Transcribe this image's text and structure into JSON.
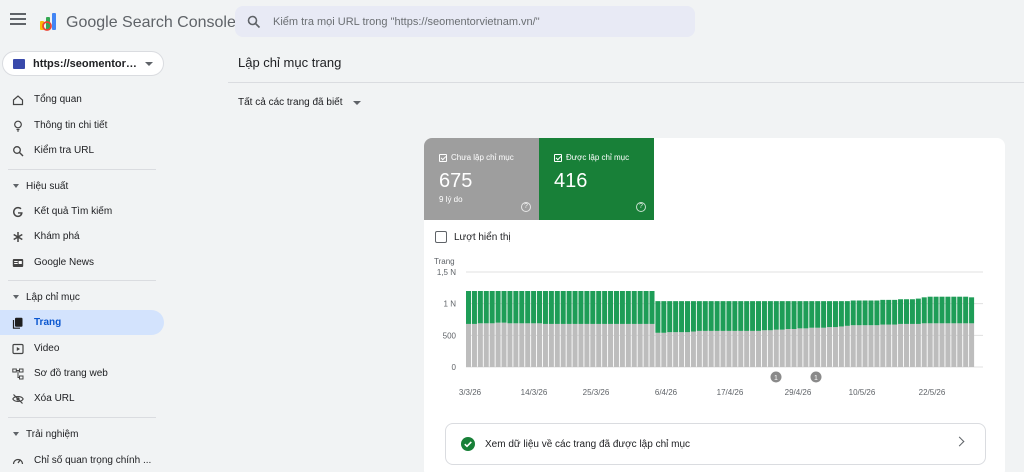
{
  "app": {
    "brand": "Google Search Console"
  },
  "search": {
    "placeholder": "Kiểm tra mọi URL trong \"https://seomentorvietnam.vn/\""
  },
  "property": {
    "label": "https://seomentorvietnam.vn/"
  },
  "sidebar": {
    "top_items": [
      {
        "label": "Tổng quan",
        "icon": "home-icon"
      },
      {
        "label": "Thông tin chi tiết",
        "icon": "lightbulb-icon"
      },
      {
        "label": "Kiểm tra URL",
        "icon": "search-icon"
      }
    ],
    "sections": [
      {
        "label": "Hiệu suất",
        "items": [
          {
            "label": "Kết quả Tìm kiếm",
            "icon": "google-g-icon"
          },
          {
            "label": "Khám phá",
            "icon": "asterisk-icon"
          },
          {
            "label": "Google News",
            "icon": "news-icon"
          }
        ]
      },
      {
        "label": "Lập chỉ mục",
        "items": [
          {
            "label": "Trang",
            "icon": "pages-icon",
            "active": true
          },
          {
            "label": "Video",
            "icon": "video-icon"
          },
          {
            "label": "Sơ đồ trang web",
            "icon": "sitemap-icon"
          },
          {
            "label": "Xóa URL",
            "icon": "eye-off-icon"
          }
        ]
      },
      {
        "label": "Trải nghiệm",
        "items": [
          {
            "label": "Chỉ số quan trọng chính ...",
            "icon": "speed-icon"
          }
        ]
      }
    ]
  },
  "main": {
    "title": "Lập chỉ mục trang",
    "filter": "Tất cả các trang đã biết",
    "metrics": {
      "not_indexed": {
        "label": "Chưa lập chỉ mục",
        "value": "675",
        "sub": "9 lý do",
        "color": "#9e9e9e"
      },
      "indexed": {
        "label": "Được lập chỉ mục",
        "value": "416",
        "color": "#188038"
      }
    },
    "impressions_label": "Lượt hiển thị",
    "link_text": "Xem dữ liệu về các trang đã được lập chỉ mục"
  },
  "chart_data": {
    "type": "bar",
    "stacked": true,
    "ylabel": "Trang",
    "yticks": [
      "0",
      "500",
      "1 N",
      "1,5 N"
    ],
    "ylim": [
      0,
      1500
    ],
    "xticks": [
      "3/3/26",
      "14/3/26",
      "25/3/26",
      "6/4/26",
      "17/4/26",
      "29/4/26",
      "10/5/26",
      "22/5/26"
    ],
    "annotations": [
      "1",
      "1"
    ],
    "series": [
      {
        "name": "Chưa lập chỉ mục",
        "color": "#bdbdbd",
        "values": [
          680,
          680,
          690,
          690,
          690,
          700,
          700,
          690,
          690,
          690,
          690,
          690,
          690,
          680,
          680,
          680,
          680,
          680,
          680,
          680,
          680,
          680,
          680,
          680,
          680,
          680,
          680,
          680,
          680,
          680,
          680,
          680,
          540,
          540,
          550,
          550,
          550,
          550,
          560,
          570,
          570,
          570,
          570,
          570,
          570,
          570,
          570,
          570,
          570,
          570,
          580,
          580,
          590,
          590,
          600,
          600,
          610,
          610,
          620,
          620,
          620,
          630,
          630,
          640,
          650,
          660,
          660,
          660,
          660,
          660,
          670,
          670,
          670,
          680,
          680,
          680,
          680,
          690,
          690,
          690,
          690,
          690,
          690,
          690,
          690,
          690
        ]
      },
      {
        "name": "Được lập chỉ mục",
        "color": "#1e9d57",
        "values": [
          520,
          520,
          510,
          510,
          510,
          500,
          500,
          510,
          510,
          510,
          510,
          510,
          510,
          520,
          520,
          520,
          520,
          520,
          520,
          520,
          520,
          520,
          520,
          520,
          520,
          520,
          520,
          520,
          520,
          520,
          520,
          520,
          500,
          500,
          490,
          490,
          490,
          490,
          480,
          470,
          470,
          470,
          470,
          470,
          470,
          470,
          470,
          470,
          470,
          470,
          460,
          460,
          450,
          450,
          440,
          440,
          430,
          430,
          420,
          420,
          420,
          410,
          410,
          400,
          390,
          390,
          390,
          390,
          390,
          390,
          390,
          390,
          390,
          390,
          390,
          390,
          400,
          410,
          420,
          420,
          420,
          420,
          420,
          420,
          420,
          410
        ]
      }
    ]
  }
}
